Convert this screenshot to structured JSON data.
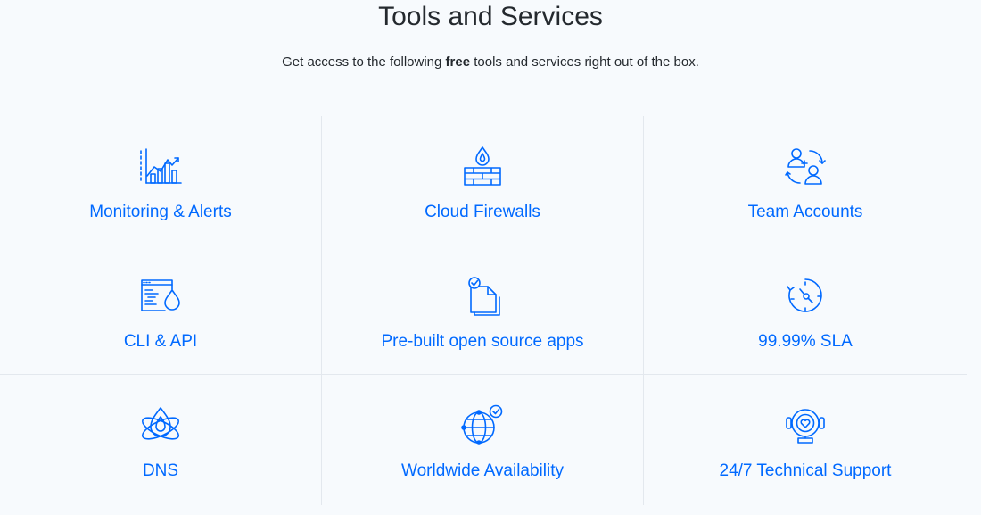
{
  "header": {
    "title": "Tools and Services",
    "subtitle_before": "Get access to the following ",
    "subtitle_bold": "free",
    "subtitle_after": " tools and services right out of the box."
  },
  "colors": {
    "accent": "#0069ff",
    "text": "#24292e",
    "divider": "#e3e8ee",
    "background": "#f7fafd"
  },
  "features": [
    {
      "label": "Monitoring & Alerts",
      "icon": "chart-icon"
    },
    {
      "label": "Cloud Firewalls",
      "icon": "firewall-icon"
    },
    {
      "label": "Team Accounts",
      "icon": "team-icon"
    },
    {
      "label": "CLI & API",
      "icon": "cli-api-icon"
    },
    {
      "label": "Pre-built open source apps",
      "icon": "document-icon"
    },
    {
      "label": "99.99% SLA",
      "icon": "clock-icon"
    },
    {
      "label": "DNS",
      "icon": "dns-icon"
    },
    {
      "label": "Worldwide Availability",
      "icon": "globe-icon"
    },
    {
      "label": "24/7 Technical Support",
      "icon": "support-icon"
    }
  ]
}
